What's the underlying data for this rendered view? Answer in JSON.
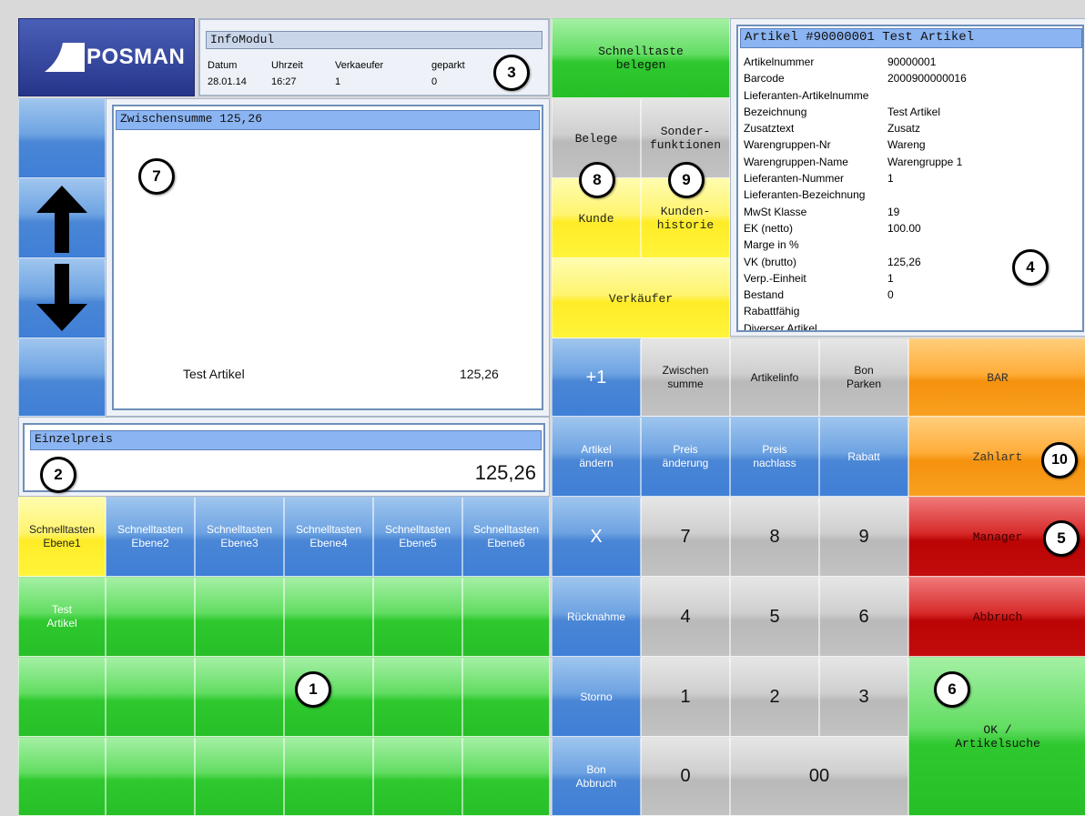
{
  "logo": {
    "text": "POSMAN"
  },
  "info_module": {
    "title": "InfoModul",
    "headers": [
      "Datum",
      "Uhrzeit",
      "Verkaeufer",
      "geparkt"
    ],
    "values": [
      "28.01.14",
      "16:27",
      "1",
      "0"
    ]
  },
  "receipt": {
    "title": "Zwischensumme 125,26",
    "item_name": "Test Artikel",
    "item_price": "125,26"
  },
  "unit_price": {
    "title": "Einzelpreis",
    "value": "125,26"
  },
  "article_panel": {
    "title": "Artikel #90000001 Test Artikel",
    "rows": [
      {
        "label": "Artikelnummer",
        "value": "90000001"
      },
      {
        "label": "Barcode",
        "value": "2000900000016"
      },
      {
        "label": "Lieferanten-Artikelnumme",
        "value": ""
      },
      {
        "label": "Bezeichnung",
        "value": "Test Artikel"
      },
      {
        "label": "Zusatztext",
        "value": "Zusatz"
      },
      {
        "label": "Warengruppen-Nr",
        "value": "Wareng"
      },
      {
        "label": "Warengruppen-Name",
        "value": "Warengruppe 1"
      },
      {
        "label": "Lieferanten-Nummer",
        "value": "1"
      },
      {
        "label": "Lieferanten-Bezeichnung",
        "value": ""
      },
      {
        "label": "MwSt Klasse",
        "value": "19"
      },
      {
        "label": "EK (netto)",
        "value": "100.00"
      },
      {
        "label": "Marge in %",
        "value": ""
      },
      {
        "label": "VK (brutto)",
        "value": "125,26"
      },
      {
        "label": "Verp.-Einheit",
        "value": "1"
      },
      {
        "label": "Bestand",
        "value": "0"
      },
      {
        "label": "Rabattfähig",
        "value": ""
      },
      {
        "label": "Diverser Artikel",
        "value": ""
      }
    ]
  },
  "buttons": {
    "schnelltaste_belegen": "Schnelltaste belegen",
    "belege": "Belege",
    "sonderfunktionen": "Sonder-funktionen",
    "kunde": "Kunde",
    "kundenhistorie": "Kunden-historie",
    "verkaeufer": "Verkäufer",
    "plus1": "+1",
    "zwischensumme": "Zwischen summe",
    "artikelinfo": "Artikelinfo",
    "bon_parken": "Bon Parken",
    "bar": "BAR",
    "artikel_aendern": "Artikel ändern",
    "preis_aenderung": "Preis änderung",
    "preis_nachlass": "Preis nachlass",
    "rabatt": "Rabatt",
    "zahlart": "Zahlart",
    "x": "X",
    "manager": "Manager",
    "ruecknahme": "Rücknahme",
    "abbruch": "Abbruch",
    "storno": "Storno",
    "bon_abbruch": "Bon Abbruch",
    "ok_artikelsuche": "OK / Artikelsuche",
    "test_artikel": "Test Artikel"
  },
  "numpad": {
    "k7": "7",
    "k8": "8",
    "k9": "9",
    "k4": "4",
    "k5": "5",
    "k6": "6",
    "k1": "1",
    "k2": "2",
    "k3": "3",
    "k0": "0",
    "k00": "00"
  },
  "quick_levels": [
    "Schnelltasten Ebene1",
    "Schnelltasten Ebene2",
    "Schnelltasten Ebene3",
    "Schnelltasten Ebene4",
    "Schnelltasten Ebene5",
    "Schnelltasten Ebene6"
  ],
  "callouts": {
    "c1": "1",
    "c2": "2",
    "c3": "3",
    "c4": "4",
    "c5": "5",
    "c6": "6",
    "c7": "7",
    "c8": "8",
    "c9": "9",
    "c10": "10"
  },
  "icons": {
    "scroll_up": "arrow-up-icon",
    "scroll_down": "arrow-down-icon",
    "logo": "posman-logo-icon"
  },
  "colors": {
    "blue": "#3f7fd6",
    "green": "#27bf27",
    "yellow": "#ffec27",
    "orange": "#f5920e",
    "red": "#bb0505",
    "gray": "#c2c2c2",
    "logo_bg": "#33459a"
  }
}
